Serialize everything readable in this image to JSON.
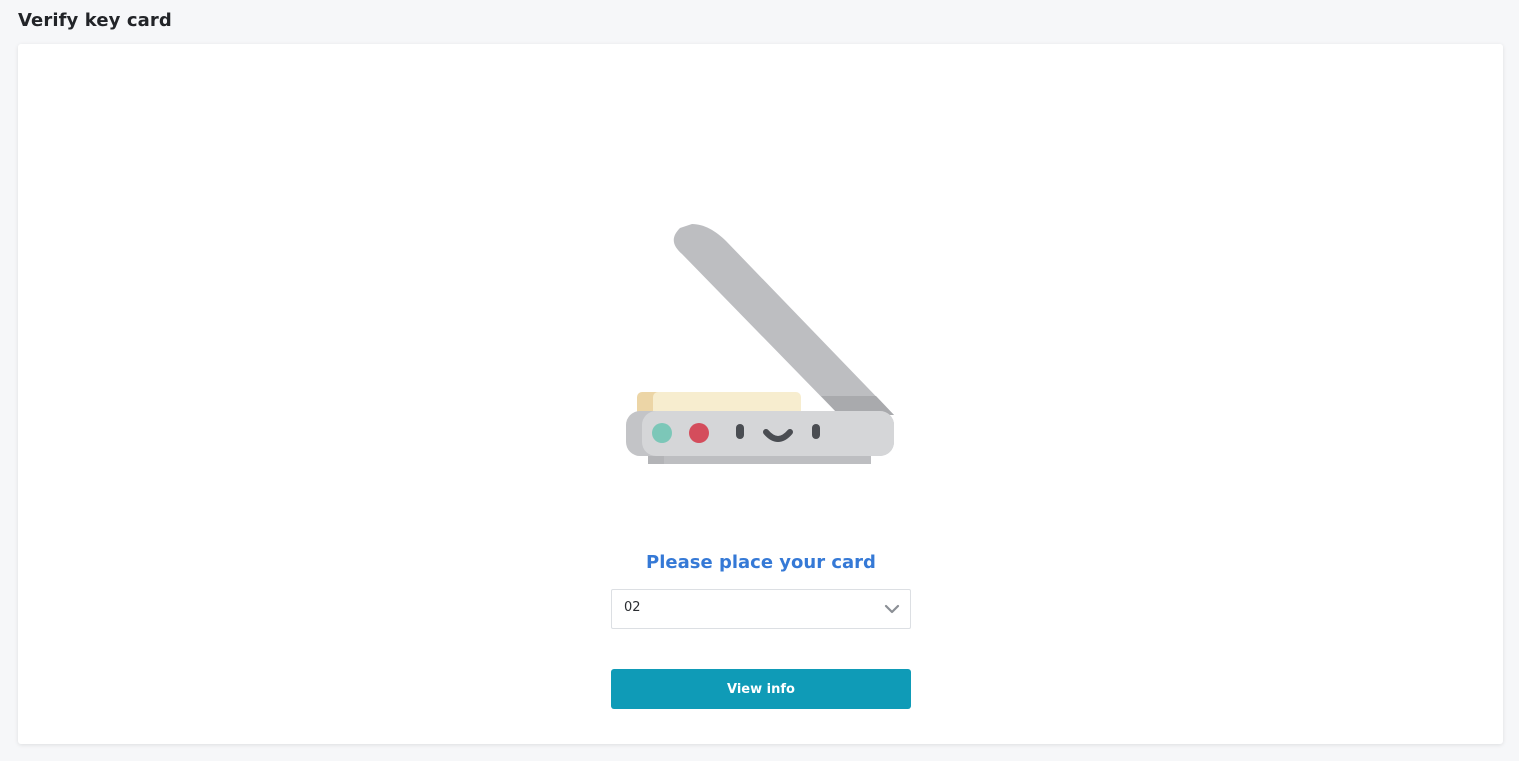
{
  "header": {
    "title": "Verify key card"
  },
  "main": {
    "illustration_icon": "card-scanner-icon",
    "prompt": "Please place your card",
    "select": {
      "value": "02"
    },
    "button_label": "View info"
  },
  "colors": {
    "prompt": "#3579d6",
    "button": "#0f9bb7",
    "background": "#f6f7f9",
    "card": "#ffffff"
  }
}
